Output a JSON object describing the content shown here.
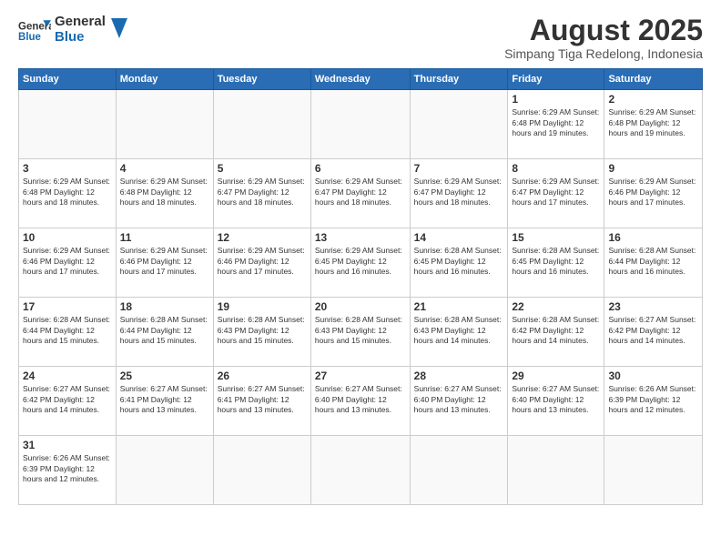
{
  "logo": {
    "text_general": "General",
    "text_blue": "Blue"
  },
  "header": {
    "month": "August 2025",
    "location": "Simpang Tiga Redelong, Indonesia"
  },
  "weekdays": [
    "Sunday",
    "Monday",
    "Tuesday",
    "Wednesday",
    "Thursday",
    "Friday",
    "Saturday"
  ],
  "weeks": [
    [
      {
        "day": "",
        "info": ""
      },
      {
        "day": "",
        "info": ""
      },
      {
        "day": "",
        "info": ""
      },
      {
        "day": "",
        "info": ""
      },
      {
        "day": "",
        "info": ""
      },
      {
        "day": "1",
        "info": "Sunrise: 6:29 AM\nSunset: 6:48 PM\nDaylight: 12 hours and 19 minutes."
      },
      {
        "day": "2",
        "info": "Sunrise: 6:29 AM\nSunset: 6:48 PM\nDaylight: 12 hours and 19 minutes."
      }
    ],
    [
      {
        "day": "3",
        "info": "Sunrise: 6:29 AM\nSunset: 6:48 PM\nDaylight: 12 hours and 18 minutes."
      },
      {
        "day": "4",
        "info": "Sunrise: 6:29 AM\nSunset: 6:48 PM\nDaylight: 12 hours and 18 minutes."
      },
      {
        "day": "5",
        "info": "Sunrise: 6:29 AM\nSunset: 6:47 PM\nDaylight: 12 hours and 18 minutes."
      },
      {
        "day": "6",
        "info": "Sunrise: 6:29 AM\nSunset: 6:47 PM\nDaylight: 12 hours and 18 minutes."
      },
      {
        "day": "7",
        "info": "Sunrise: 6:29 AM\nSunset: 6:47 PM\nDaylight: 12 hours and 18 minutes."
      },
      {
        "day": "8",
        "info": "Sunrise: 6:29 AM\nSunset: 6:47 PM\nDaylight: 12 hours and 17 minutes."
      },
      {
        "day": "9",
        "info": "Sunrise: 6:29 AM\nSunset: 6:46 PM\nDaylight: 12 hours and 17 minutes."
      }
    ],
    [
      {
        "day": "10",
        "info": "Sunrise: 6:29 AM\nSunset: 6:46 PM\nDaylight: 12 hours and 17 minutes."
      },
      {
        "day": "11",
        "info": "Sunrise: 6:29 AM\nSunset: 6:46 PM\nDaylight: 12 hours and 17 minutes."
      },
      {
        "day": "12",
        "info": "Sunrise: 6:29 AM\nSunset: 6:46 PM\nDaylight: 12 hours and 17 minutes."
      },
      {
        "day": "13",
        "info": "Sunrise: 6:29 AM\nSunset: 6:45 PM\nDaylight: 12 hours and 16 minutes."
      },
      {
        "day": "14",
        "info": "Sunrise: 6:28 AM\nSunset: 6:45 PM\nDaylight: 12 hours and 16 minutes."
      },
      {
        "day": "15",
        "info": "Sunrise: 6:28 AM\nSunset: 6:45 PM\nDaylight: 12 hours and 16 minutes."
      },
      {
        "day": "16",
        "info": "Sunrise: 6:28 AM\nSunset: 6:44 PM\nDaylight: 12 hours and 16 minutes."
      }
    ],
    [
      {
        "day": "17",
        "info": "Sunrise: 6:28 AM\nSunset: 6:44 PM\nDaylight: 12 hours and 15 minutes."
      },
      {
        "day": "18",
        "info": "Sunrise: 6:28 AM\nSunset: 6:44 PM\nDaylight: 12 hours and 15 minutes."
      },
      {
        "day": "19",
        "info": "Sunrise: 6:28 AM\nSunset: 6:43 PM\nDaylight: 12 hours and 15 minutes."
      },
      {
        "day": "20",
        "info": "Sunrise: 6:28 AM\nSunset: 6:43 PM\nDaylight: 12 hours and 15 minutes."
      },
      {
        "day": "21",
        "info": "Sunrise: 6:28 AM\nSunset: 6:43 PM\nDaylight: 12 hours and 14 minutes."
      },
      {
        "day": "22",
        "info": "Sunrise: 6:28 AM\nSunset: 6:42 PM\nDaylight: 12 hours and 14 minutes."
      },
      {
        "day": "23",
        "info": "Sunrise: 6:27 AM\nSunset: 6:42 PM\nDaylight: 12 hours and 14 minutes."
      }
    ],
    [
      {
        "day": "24",
        "info": "Sunrise: 6:27 AM\nSunset: 6:42 PM\nDaylight: 12 hours and 14 minutes."
      },
      {
        "day": "25",
        "info": "Sunrise: 6:27 AM\nSunset: 6:41 PM\nDaylight: 12 hours and 13 minutes."
      },
      {
        "day": "26",
        "info": "Sunrise: 6:27 AM\nSunset: 6:41 PM\nDaylight: 12 hours and 13 minutes."
      },
      {
        "day": "27",
        "info": "Sunrise: 6:27 AM\nSunset: 6:40 PM\nDaylight: 12 hours and 13 minutes."
      },
      {
        "day": "28",
        "info": "Sunrise: 6:27 AM\nSunset: 6:40 PM\nDaylight: 12 hours and 13 minutes."
      },
      {
        "day": "29",
        "info": "Sunrise: 6:27 AM\nSunset: 6:40 PM\nDaylight: 12 hours and 13 minutes."
      },
      {
        "day": "30",
        "info": "Sunrise: 6:26 AM\nSunset: 6:39 PM\nDaylight: 12 hours and 12 minutes."
      }
    ],
    [
      {
        "day": "31",
        "info": "Sunrise: 6:26 AM\nSunset: 6:39 PM\nDaylight: 12 hours and 12 minutes."
      },
      {
        "day": "",
        "info": ""
      },
      {
        "day": "",
        "info": ""
      },
      {
        "day": "",
        "info": ""
      },
      {
        "day": "",
        "info": ""
      },
      {
        "day": "",
        "info": ""
      },
      {
        "day": "",
        "info": ""
      }
    ]
  ]
}
